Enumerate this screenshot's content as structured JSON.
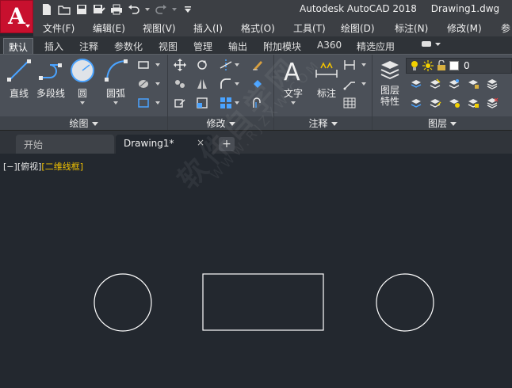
{
  "title": {
    "app_name": "Autodesk AutoCAD 2018",
    "document": "Drawing1.dwg"
  },
  "app_logo": {
    "letter": "A"
  },
  "menu": [
    "文件(F)",
    "编辑(E)",
    "视图(V)",
    "插入(I)",
    "格式(O)",
    "工具(T)",
    "绘图(D)",
    "标注(N)",
    "修改(M)",
    "参"
  ],
  "ribbon_tabs": [
    "默认",
    "插入",
    "注释",
    "参数化",
    "视图",
    "管理",
    "输出",
    "附加模块",
    "A360",
    "精选应用"
  ],
  "ribbon": {
    "draw": {
      "title": "绘图",
      "line": "直线",
      "polyline": "多段线",
      "circle": "圆",
      "arc": "圆弧"
    },
    "modify": {
      "title": "修改"
    },
    "annotation": {
      "title": "注释",
      "text": "文字",
      "dimension": "标注"
    },
    "layers": {
      "title": "图层",
      "properties_line1": "图层",
      "properties_line2": "特性",
      "current_layer": "0"
    }
  },
  "file_tabs": {
    "start": "开始",
    "doc": "Drawing1*",
    "close": "×",
    "new": "+"
  },
  "viewport": {
    "control": "[−]",
    "view": "[俯视]",
    "style": "[二维线框]"
  },
  "watermark": {
    "cn": "软件自学网",
    "url": "WWW.RJZXW.COM"
  },
  "colors": {
    "logo_red": "#c8102e",
    "canvas_bg": "#23282f",
    "ribbon_bg": "#4b5058",
    "viewport_style_yellow": "#f2c200"
  }
}
